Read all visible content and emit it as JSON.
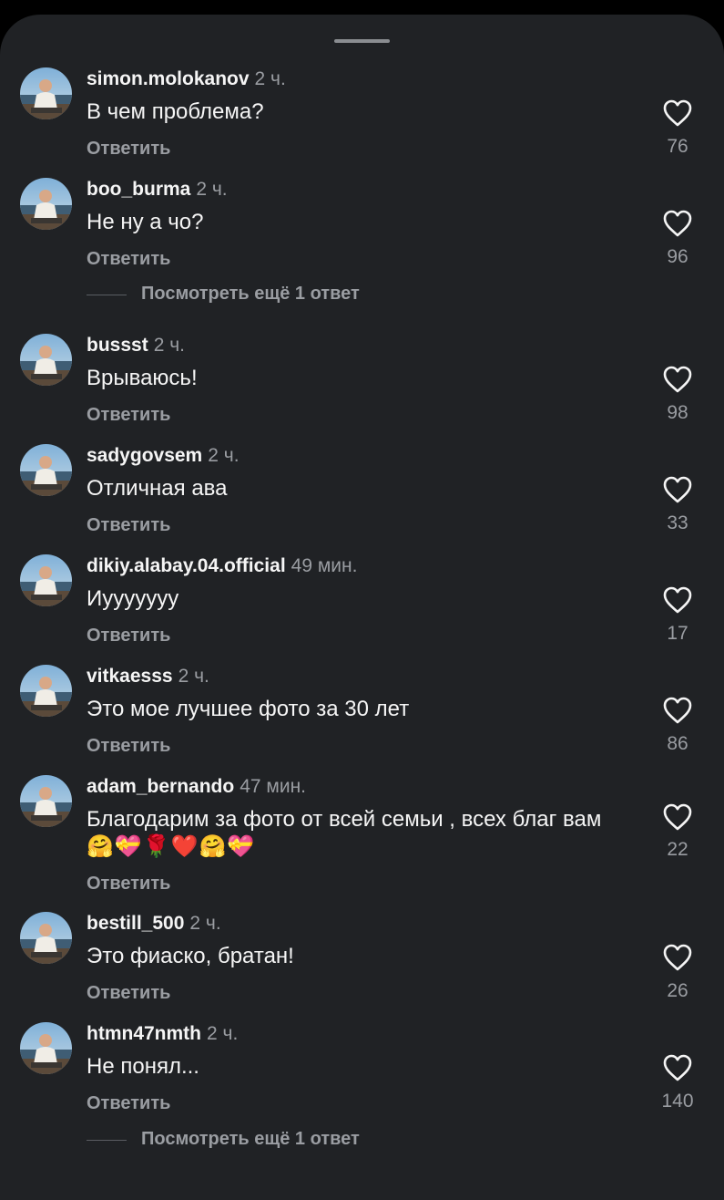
{
  "sheet": {
    "handle": "drag-handle"
  },
  "reply_label": "Ответить",
  "more_replies_label": "Посмотреть ещё 1 ответ",
  "comments": [
    {
      "username": "simon.molokanov",
      "time": "2 ч.",
      "text": "В чем проблема?",
      "likes": "76"
    },
    {
      "username": "boo_burma",
      "time": "2 ч.",
      "text": "Не ну а чо?",
      "likes": "96"
    },
    {
      "username": "bussst",
      "time": "2 ч.",
      "text": "Врываюсь!",
      "likes": "98"
    },
    {
      "username": "sadygovsem",
      "time": "2 ч.",
      "text": "Отличная ава",
      "likes": "33"
    },
    {
      "username": "dikiy.alabay.04.official",
      "time": "49 мин.",
      "text": "Иууууууу",
      "likes": "17"
    },
    {
      "username": "vitkaesss",
      "time": "2 ч.",
      "text": "Это мое лучшее фото за 30 лет",
      "likes": "86"
    },
    {
      "username": "adam_bernando",
      "time": "47 мин.",
      "text": "Благодарим за фото от всей семьи , всех благ вам",
      "emoji": "🤗💝🌹❤️🤗💝",
      "likes": "22"
    },
    {
      "username": "bestill_500",
      "time": "2 ч.",
      "text": "Это фиаско, братан!",
      "likes": "26"
    },
    {
      "username": "htmn47nmth",
      "time": "2 ч.",
      "text": "Не понял...",
      "likes": "140"
    }
  ],
  "icons": {
    "avatar": "profile-photo",
    "like": "heart-outline-icon"
  },
  "colors": {
    "background": "#202225",
    "text": "#f5f5f5",
    "secondary": "#9a9da2"
  }
}
